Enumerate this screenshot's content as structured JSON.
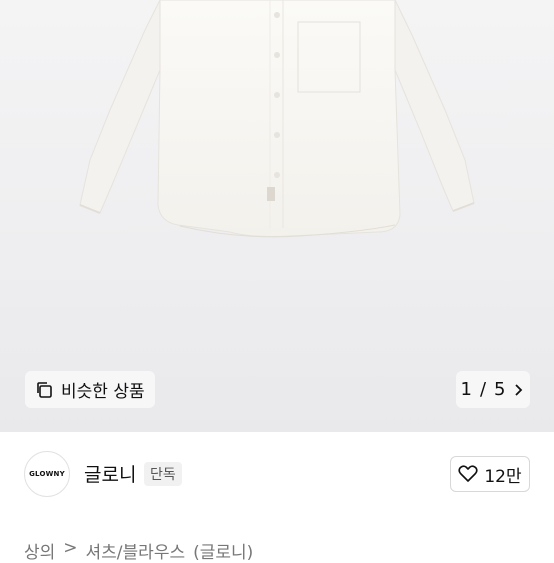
{
  "gallery": {
    "similar_label": "비슷한 상품",
    "counter": {
      "current": "1",
      "separator": "/",
      "total": "5"
    }
  },
  "brand": {
    "logo_text": "GLOWNY",
    "name": "글로니",
    "badge": "단독",
    "likes": "12만"
  },
  "breadcrumb": {
    "items": [
      "상의",
      "셔츠/블라우스",
      "(글로니)"
    ],
    "separator": ">"
  },
  "icons": [
    "copy-icon",
    "chevron-right-icon",
    "heart-icon"
  ]
}
